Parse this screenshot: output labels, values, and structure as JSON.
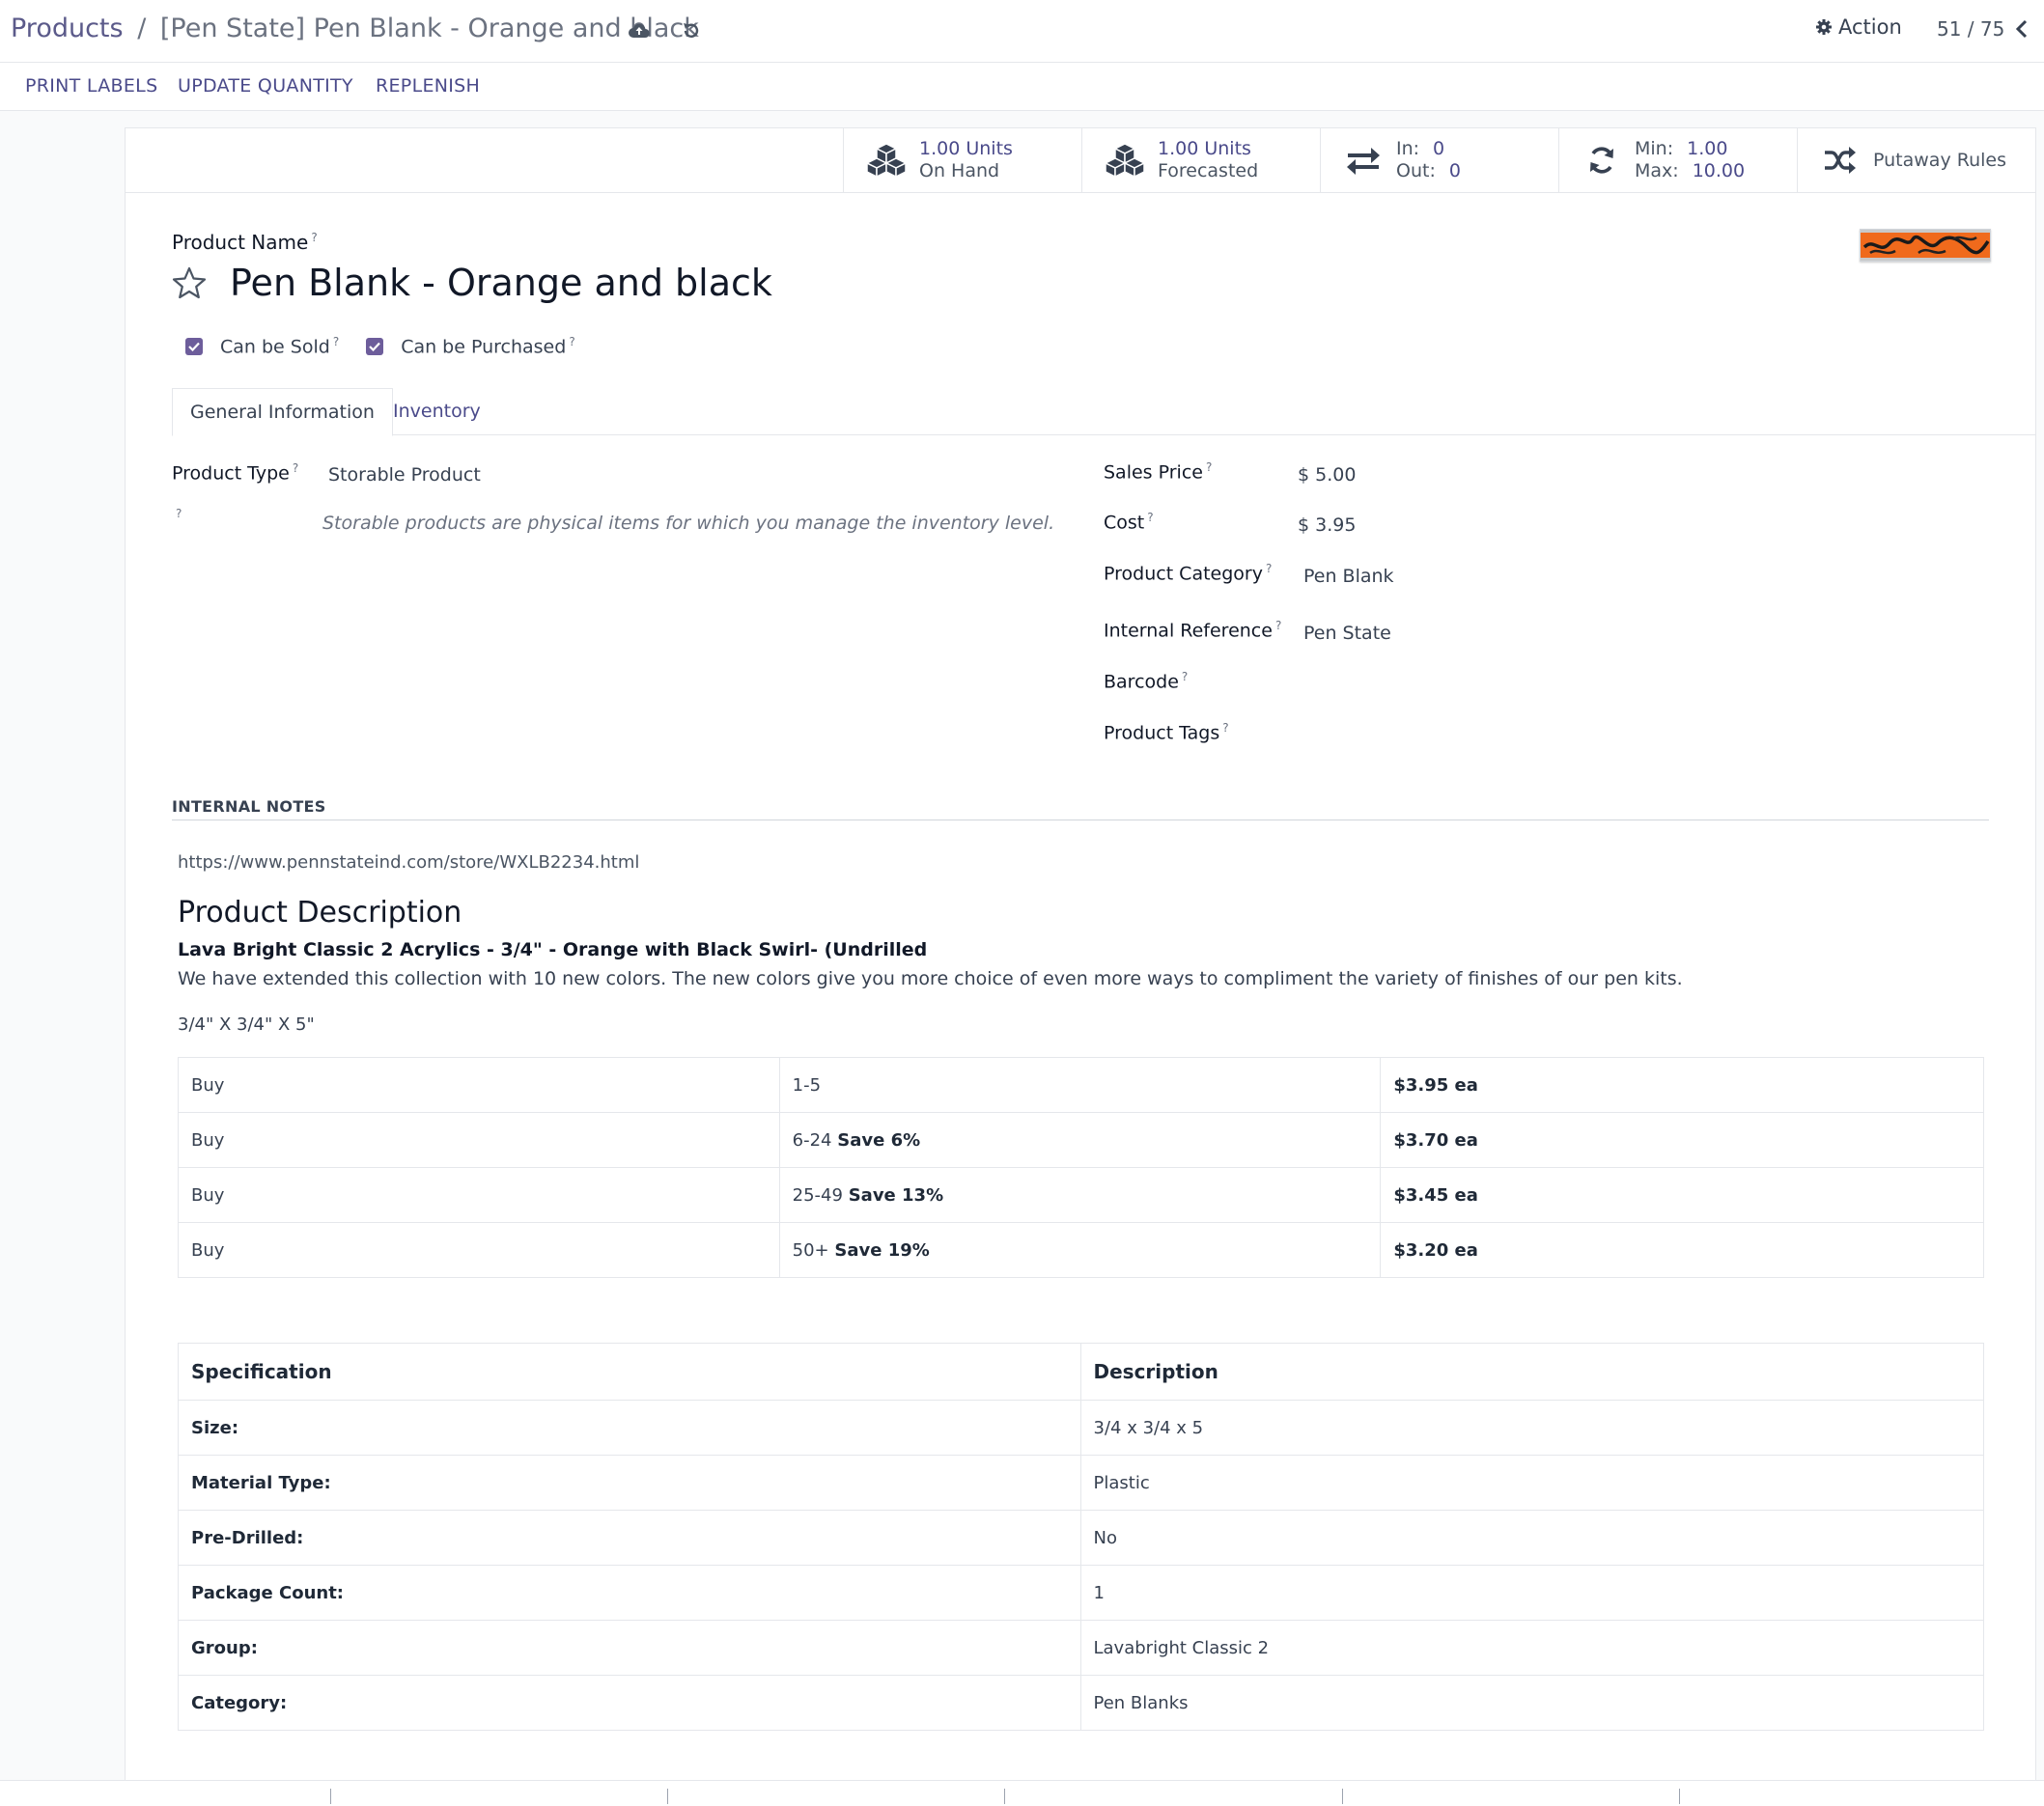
{
  "breadcrumb": {
    "parent": "Products",
    "separator": "/",
    "current": "[Pen State] Pen Blank - Orange and black"
  },
  "header": {
    "action_label": "Action",
    "pager": "51 / 75"
  },
  "control": {
    "print_labels": "PRINT LABELS",
    "update_quantity": "UPDATE QUANTITY",
    "replenish": "REPLENISH"
  },
  "stats": {
    "on_hand_value": "1.00 Units",
    "on_hand_label": "On Hand",
    "forecast_value": "1.00 Units",
    "forecast_label": "Forecasted",
    "in_label": "In:",
    "in_value": "0",
    "out_label": "Out:",
    "out_value": "0",
    "min_label": "Min:",
    "min_value": "1.00",
    "max_label": "Max:",
    "max_value": "10.00",
    "putaway_label": "Putaway Rules"
  },
  "product": {
    "name_label": "Product Name",
    "name": "Pen Blank - Orange and black",
    "can_be_sold": "Can be Sold",
    "can_be_purchased": "Can be Purchased"
  },
  "tabs": {
    "general": "General Information",
    "inventory": "Inventory"
  },
  "general": {
    "product_type_label": "Product Type",
    "product_type": "Storable Product",
    "type_help": "Storable products are physical items for which you manage the inventory level.",
    "sales_price_label": "Sales Price",
    "sales_price": "$ 5.00",
    "cost_label": "Cost",
    "cost": "$ 3.95",
    "category_label": "Product Category",
    "category": "Pen Blank",
    "internal_ref_label": "Internal Reference",
    "internal_ref": "Pen State",
    "barcode_label": "Barcode",
    "tags_label": "Product Tags",
    "help_mark": "?"
  },
  "notes": {
    "heading": "INTERNAL NOTES",
    "url": "https://www.pennstateind.com/store/WXLB2234.html",
    "desc_heading": "Product Description",
    "subtitle": "Lava Bright Classic 2 Acrylics - 3/4\" - Orange with Black Swirl- (Undrilled",
    "paragraph": "We have extended this collection with 10 new colors. The new colors give you more choice of even more ways to compliment the variety of finishes of our pen kits.",
    "dimensions": "3/4\" X 3/4\" X 5\""
  },
  "pricing": [
    {
      "buy": "Buy",
      "qty": "1-5",
      "save": "",
      "price": "$3.95 ea"
    },
    {
      "buy": "Buy",
      "qty": "6-24",
      "save": "Save 6%",
      "price": "$3.70 ea"
    },
    {
      "buy": "Buy",
      "qty": "25-49",
      "save": "Save 13%",
      "price": "$3.45 ea"
    },
    {
      "buy": "Buy",
      "qty": "50+",
      "save": "Save 19%",
      "price": "$3.20 ea"
    }
  ],
  "spec": {
    "head_key": "Specification",
    "head_val": "Description",
    "rows": [
      {
        "k": "Size:",
        "v": "3/4 x 3/4 x 5"
      },
      {
        "k": "Material Type:",
        "v": "Plastic"
      },
      {
        "k": "Pre-Drilled:",
        "v": "No"
      },
      {
        "k": "Package Count:",
        "v": "1"
      },
      {
        "k": "Group:",
        "v": "Lavabright Classic 2"
      },
      {
        "k": "Category:",
        "v": "Pen Blanks"
      }
    ]
  },
  "colors": {
    "accent": "#4a4a8a",
    "checkbox": "#6d5d9b",
    "blank_orange": "#f06a1c"
  },
  "icons": [
    "cloud-upload-icon",
    "undo-icon",
    "gear-icon",
    "chevron-left-icon",
    "cubes-icon",
    "arrows-exchange-icon",
    "refresh-icon",
    "shuffle-icon",
    "star-icon",
    "check-icon"
  ]
}
